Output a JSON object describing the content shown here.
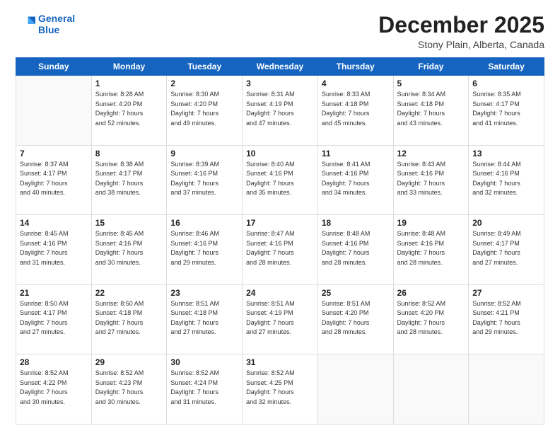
{
  "logo": {
    "line1": "General",
    "line2": "Blue"
  },
  "title": "December 2025",
  "location": "Stony Plain, Alberta, Canada",
  "days_header": [
    "Sunday",
    "Monday",
    "Tuesday",
    "Wednesday",
    "Thursday",
    "Friday",
    "Saturday"
  ],
  "weeks": [
    [
      {
        "day": "",
        "info": ""
      },
      {
        "day": "1",
        "info": "Sunrise: 8:28 AM\nSunset: 4:20 PM\nDaylight: 7 hours\nand 52 minutes."
      },
      {
        "day": "2",
        "info": "Sunrise: 8:30 AM\nSunset: 4:20 PM\nDaylight: 7 hours\nand 49 minutes."
      },
      {
        "day": "3",
        "info": "Sunrise: 8:31 AM\nSunset: 4:19 PM\nDaylight: 7 hours\nand 47 minutes."
      },
      {
        "day": "4",
        "info": "Sunrise: 8:33 AM\nSunset: 4:18 PM\nDaylight: 7 hours\nand 45 minutes."
      },
      {
        "day": "5",
        "info": "Sunrise: 8:34 AM\nSunset: 4:18 PM\nDaylight: 7 hours\nand 43 minutes."
      },
      {
        "day": "6",
        "info": "Sunrise: 8:35 AM\nSunset: 4:17 PM\nDaylight: 7 hours\nand 41 minutes."
      }
    ],
    [
      {
        "day": "7",
        "info": "Sunrise: 8:37 AM\nSunset: 4:17 PM\nDaylight: 7 hours\nand 40 minutes."
      },
      {
        "day": "8",
        "info": "Sunrise: 8:38 AM\nSunset: 4:17 PM\nDaylight: 7 hours\nand 38 minutes."
      },
      {
        "day": "9",
        "info": "Sunrise: 8:39 AM\nSunset: 4:16 PM\nDaylight: 7 hours\nand 37 minutes."
      },
      {
        "day": "10",
        "info": "Sunrise: 8:40 AM\nSunset: 4:16 PM\nDaylight: 7 hours\nand 35 minutes."
      },
      {
        "day": "11",
        "info": "Sunrise: 8:41 AM\nSunset: 4:16 PM\nDaylight: 7 hours\nand 34 minutes."
      },
      {
        "day": "12",
        "info": "Sunrise: 8:43 AM\nSunset: 4:16 PM\nDaylight: 7 hours\nand 33 minutes."
      },
      {
        "day": "13",
        "info": "Sunrise: 8:44 AM\nSunset: 4:16 PM\nDaylight: 7 hours\nand 32 minutes."
      }
    ],
    [
      {
        "day": "14",
        "info": "Sunrise: 8:45 AM\nSunset: 4:16 PM\nDaylight: 7 hours\nand 31 minutes."
      },
      {
        "day": "15",
        "info": "Sunrise: 8:45 AM\nSunset: 4:16 PM\nDaylight: 7 hours\nand 30 minutes."
      },
      {
        "day": "16",
        "info": "Sunrise: 8:46 AM\nSunset: 4:16 PM\nDaylight: 7 hours\nand 29 minutes."
      },
      {
        "day": "17",
        "info": "Sunrise: 8:47 AM\nSunset: 4:16 PM\nDaylight: 7 hours\nand 28 minutes."
      },
      {
        "day": "18",
        "info": "Sunrise: 8:48 AM\nSunset: 4:16 PM\nDaylight: 7 hours\nand 28 minutes."
      },
      {
        "day": "19",
        "info": "Sunrise: 8:48 AM\nSunset: 4:16 PM\nDaylight: 7 hours\nand 28 minutes."
      },
      {
        "day": "20",
        "info": "Sunrise: 8:49 AM\nSunset: 4:17 PM\nDaylight: 7 hours\nand 27 minutes."
      }
    ],
    [
      {
        "day": "21",
        "info": "Sunrise: 8:50 AM\nSunset: 4:17 PM\nDaylight: 7 hours\nand 27 minutes."
      },
      {
        "day": "22",
        "info": "Sunrise: 8:50 AM\nSunset: 4:18 PM\nDaylight: 7 hours\nand 27 minutes."
      },
      {
        "day": "23",
        "info": "Sunrise: 8:51 AM\nSunset: 4:18 PM\nDaylight: 7 hours\nand 27 minutes."
      },
      {
        "day": "24",
        "info": "Sunrise: 8:51 AM\nSunset: 4:19 PM\nDaylight: 7 hours\nand 27 minutes."
      },
      {
        "day": "25",
        "info": "Sunrise: 8:51 AM\nSunset: 4:20 PM\nDaylight: 7 hours\nand 28 minutes."
      },
      {
        "day": "26",
        "info": "Sunrise: 8:52 AM\nSunset: 4:20 PM\nDaylight: 7 hours\nand 28 minutes."
      },
      {
        "day": "27",
        "info": "Sunrise: 8:52 AM\nSunset: 4:21 PM\nDaylight: 7 hours\nand 29 minutes."
      }
    ],
    [
      {
        "day": "28",
        "info": "Sunrise: 8:52 AM\nSunset: 4:22 PM\nDaylight: 7 hours\nand 30 minutes."
      },
      {
        "day": "29",
        "info": "Sunrise: 8:52 AM\nSunset: 4:23 PM\nDaylight: 7 hours\nand 30 minutes."
      },
      {
        "day": "30",
        "info": "Sunrise: 8:52 AM\nSunset: 4:24 PM\nDaylight: 7 hours\nand 31 minutes."
      },
      {
        "day": "31",
        "info": "Sunrise: 8:52 AM\nSunset: 4:25 PM\nDaylight: 7 hours\nand 32 minutes."
      },
      {
        "day": "",
        "info": ""
      },
      {
        "day": "",
        "info": ""
      },
      {
        "day": "",
        "info": ""
      }
    ]
  ]
}
